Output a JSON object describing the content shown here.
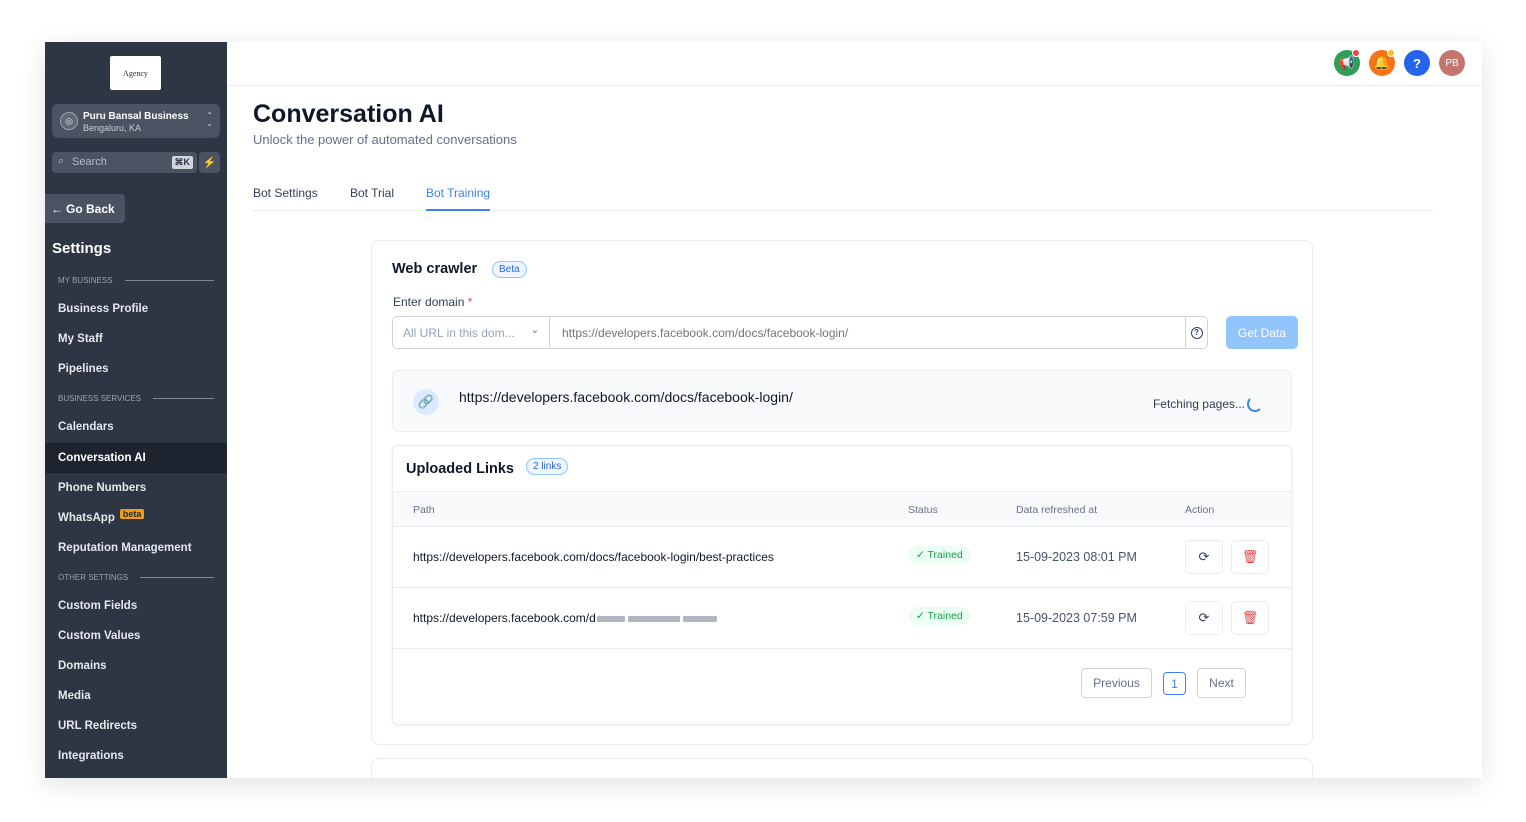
{
  "sidebar": {
    "logo_text": "Agency",
    "account": {
      "name": "Puru Bansal Business",
      "location": "Bengaluru, KA"
    },
    "search": {
      "label": "Search",
      "shortcut": "⌘K"
    },
    "go_back": "Go Back",
    "title": "Settings",
    "sections": {
      "my_business": "MY BUSINESS",
      "business_services": "BUSINESS SERVICES",
      "other_settings": "OTHER SETTINGS"
    },
    "items": [
      {
        "label": "Business Profile"
      },
      {
        "label": "My Staff"
      },
      {
        "label": "Pipelines"
      },
      {
        "label": "Calendars"
      },
      {
        "label": "Conversation AI"
      },
      {
        "label": "Phone Numbers"
      },
      {
        "label": "WhatsApp",
        "badge": "beta"
      },
      {
        "label": "Reputation Management"
      },
      {
        "label": "Custom Fields"
      },
      {
        "label": "Custom Values"
      },
      {
        "label": "Domains"
      },
      {
        "label": "Media"
      },
      {
        "label": "URL Redirects"
      },
      {
        "label": "Integrations"
      }
    ]
  },
  "header": {
    "icons": [
      "megaphone-icon",
      "bell-icon",
      "help-icon"
    ],
    "avatar_initials": "PB",
    "colors": {
      "megaphone": "#2f9e57",
      "bell": "#f97316",
      "help": "#2563eb",
      "avatar": "#c2766e"
    }
  },
  "page": {
    "title": "Conversation AI",
    "subtitle": "Unlock the power of automated conversations",
    "tabs": [
      {
        "label": "Bot Settings"
      },
      {
        "label": "Bot Trial"
      },
      {
        "label": "Bot Training"
      }
    ],
    "active_tab": "Bot Training"
  },
  "web_crawler": {
    "title": "Web crawler",
    "badge": "Beta",
    "domain_label": "Enter domain",
    "required_mark": "*",
    "scope_value": "All URL in this dom...",
    "url_placeholder": "https://developers.facebook.com/docs/facebook-login/",
    "get_data_label": "Get Data",
    "fetching_url": "https://developers.facebook.com/docs/facebook-login/",
    "fetching_status": "Fetching pages..."
  },
  "uploaded_links": {
    "title": "Uploaded Links",
    "count_badge": "2 links",
    "columns": [
      "Path",
      "Status",
      "Data refreshed at",
      "Action"
    ],
    "rows": [
      {
        "path": "https://developers.facebook.com/docs/facebook-login/best-practices",
        "status": "Trained",
        "refreshed": "15-09-2023 08:01 PM"
      },
      {
        "path": "https://developers.facebook.com/d",
        "status": "Trained",
        "refreshed": "15-09-2023 07:59 PM"
      }
    ],
    "pagination": {
      "previous": "Previous",
      "current": "1",
      "next": "Next"
    }
  },
  "accent_color": "#3b82f6"
}
